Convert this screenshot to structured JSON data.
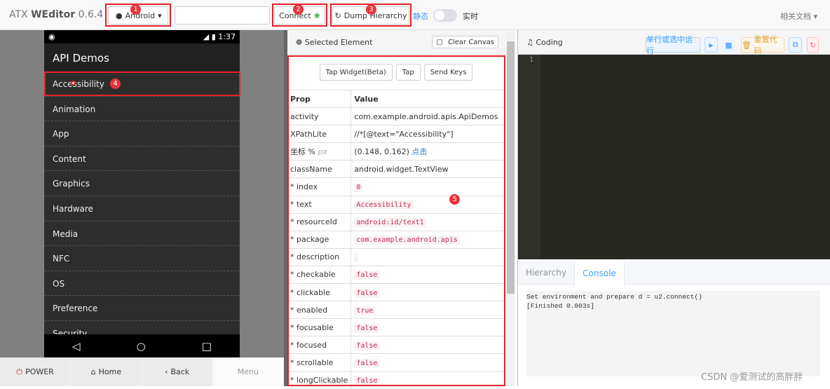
{
  "app": {
    "brand": "WEditor",
    "brand_prefix": "ATX",
    "version": "0.6.4"
  },
  "toolbar": {
    "platform": "Android",
    "device_input": "",
    "connect": "Connect",
    "dump": "Dump Hierarchy",
    "static_label": "静态",
    "live_label": "实时",
    "docs": "相关文档"
  },
  "phone": {
    "time": "1:37",
    "title": "API Demos",
    "items": [
      "Accessibility",
      "Animation",
      "App",
      "Content",
      "Graphics",
      "Hardware",
      "Media",
      "NFC",
      "OS",
      "Preference",
      "Security"
    ]
  },
  "device_buttons": {
    "power": "POWER",
    "home": "Home",
    "back": "Back",
    "menu": "Menu"
  },
  "selected": {
    "title": "Selected Element",
    "clear": "Clear Canvas",
    "tap_widget": "Tap Widget(Beta)",
    "tap": "Tap",
    "send_keys": "Send Keys",
    "col_prop": "Prop",
    "col_value": "Value",
    "rows": [
      {
        "prop": "activity",
        "value": "com.example.android.apis.ApiDemos",
        "code": false
      },
      {
        "prop": "XPathLite",
        "value": "//*[@text=\"Accessibility\"]",
        "code": false
      },
      {
        "prop": "坐标 %",
        "prop_extra": "px",
        "value": "(0.148, 0.162)",
        "link": "点击",
        "code": false
      },
      {
        "prop": "className",
        "value": "android.widget.TextView",
        "code": false
      },
      {
        "prop": "* index",
        "value": "0",
        "code": true
      },
      {
        "prop": "* text",
        "value": "Accessibility",
        "code": true
      },
      {
        "prop": "* resourceId",
        "value": "android:id/text1",
        "code": true
      },
      {
        "prop": "* package",
        "value": "com.example.android.apis",
        "code": true
      },
      {
        "prop": "* description",
        "value": "",
        "code": true
      },
      {
        "prop": "* checkable",
        "value": "false",
        "code": true
      },
      {
        "prop": "* clickable",
        "value": "false",
        "code": true
      },
      {
        "prop": "* enabled",
        "value": "true",
        "code": true
      },
      {
        "prop": "* focusable",
        "value": "false",
        "code": true
      },
      {
        "prop": "* focused",
        "value": "false",
        "code": true
      },
      {
        "prop": "* scrollable",
        "value": "false",
        "code": true
      },
      {
        "prop": "* longClickable",
        "value": "false",
        "code": true
      }
    ]
  },
  "coding": {
    "title": "Coding",
    "run_line": "单行或选中运行",
    "reset": "重置代码",
    "line_no": "1"
  },
  "bottom_tabs": {
    "hierarchy": "Hierarchy",
    "console": "Console"
  },
  "console": {
    "lines": "Set environment and prepare d = u2.connect()\n[Finished 0.003s]"
  },
  "annotations": [
    "1",
    "2",
    "3",
    "4",
    "5"
  ],
  "watermark": "CSDN @爱测试的高胖胖",
  "colors": {
    "accent": "#409eff",
    "annotation": "#e8202a",
    "editor_bg": "#272822"
  }
}
